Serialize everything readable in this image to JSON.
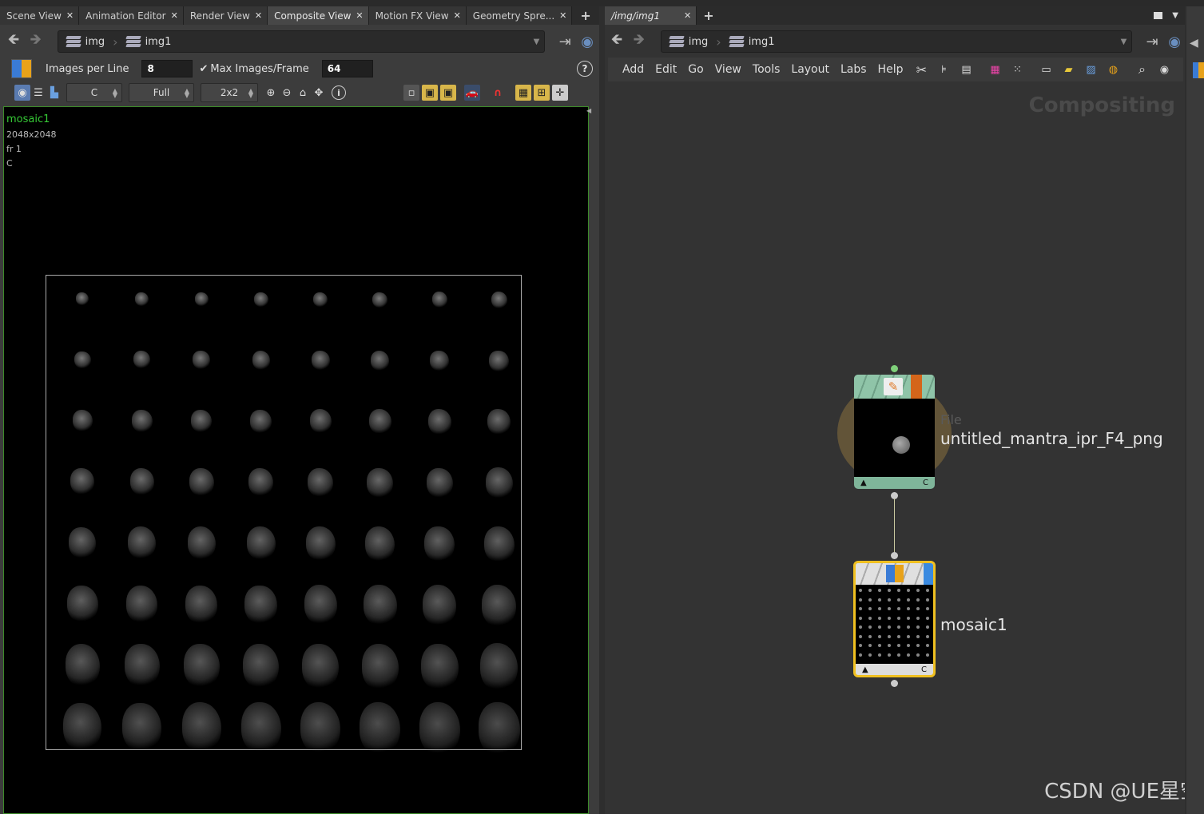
{
  "left_tabs": [
    "Scene View",
    "Animation Editor",
    "Render View",
    "Composite View",
    "Motion FX View",
    "Geometry Spre..."
  ],
  "left_active_tab": "Composite View",
  "right_tabs": [
    "/img/img1"
  ],
  "path": {
    "crumb1": "img",
    "crumb2": "img1"
  },
  "composite_toolbar": {
    "images_per_line_label": "Images per Line",
    "images_per_line_value": "8",
    "max_images_label": "Max Images/Frame",
    "max_images_value": "64",
    "plane_select": "C",
    "resolution_select": "Full",
    "grid_select": "2x2"
  },
  "viewer_info": {
    "name": "mosaic1",
    "resolution": "2048x2048",
    "frame": "fr 1",
    "plane": "C"
  },
  "network_menu": [
    "Add",
    "Edit",
    "Go",
    "View",
    "Tools",
    "Layout",
    "Labs",
    "Help"
  ],
  "network_watermark": "Compositing",
  "nodes": {
    "file_node": {
      "type_label": "File",
      "name": "untitled_mantra_ipr_F4_png",
      "plane": "C"
    },
    "mosaic_node": {
      "name": "mosaic1",
      "plane": "C"
    }
  },
  "mosaic": {
    "rows": 8,
    "cols": 8
  },
  "watermark": "CSDN @UE星空",
  "colors": {
    "accent_green": "#3d8a2a",
    "node_file_header": "#7fb59a",
    "node_selected": "#f0c020",
    "viewer_name": "#35c935"
  }
}
